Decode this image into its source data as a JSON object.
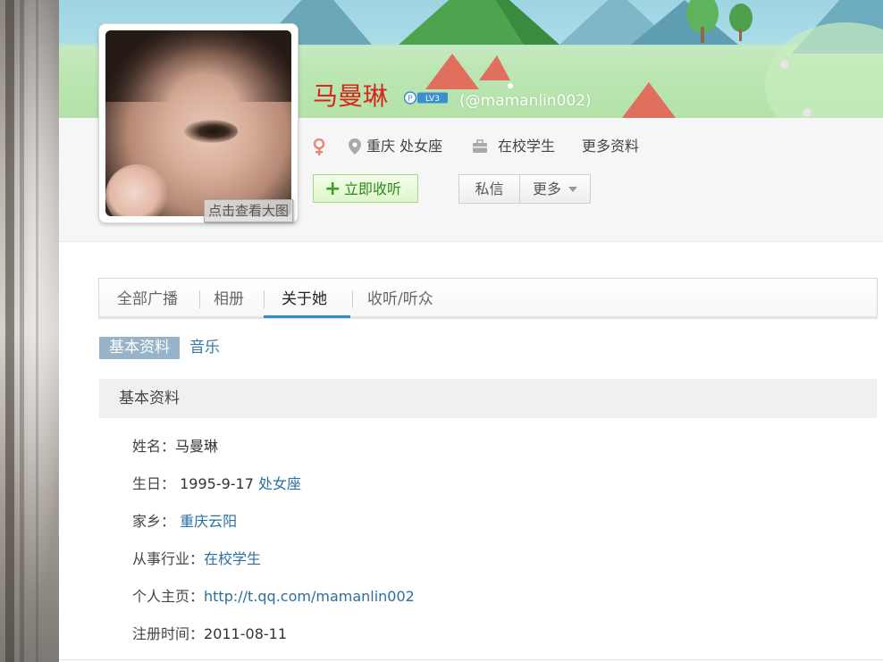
{
  "profile": {
    "name": "马曼琳",
    "handle": "(@mamanlin002)",
    "level_badge": "LV3",
    "avatar_link": "点击查看大图",
    "location": "重庆 处女座",
    "occupation": "在校学生",
    "more_info": "更多资料",
    "gender_icon": "female-icon"
  },
  "actions": {
    "follow": "立即收听",
    "message": "私信",
    "more": "更多"
  },
  "tabs": [
    {
      "label": "全部广播"
    },
    {
      "label": "相册"
    },
    {
      "label": "关于她"
    },
    {
      "label": "收听/听众"
    }
  ],
  "subtabs": {
    "active": "基本资料",
    "other": "音乐"
  },
  "section": {
    "title": "基本资料"
  },
  "fields": {
    "name_label": "姓名：",
    "name_value": "马曼琳",
    "birthday_label": "生日：",
    "birthday_value": "1995-9-17",
    "birthday_sign": "处女座",
    "hometown_label": "家乡：",
    "hometown_value": "重庆云阳",
    "industry_label": "从事行业：",
    "industry_value": "在校学生",
    "homepage_label": "个人主页：",
    "homepage_value": "http://t.qq.com/mamanlin002",
    "register_label": "注册时间：",
    "register_value": "2011-08-11"
  },
  "colors": {
    "name": "#d8261c",
    "link": "#2a6fa1",
    "tab_accent": "#2d8ecb",
    "follow_green": "#39a023",
    "subtab_active_bg": "#97b3c9"
  }
}
